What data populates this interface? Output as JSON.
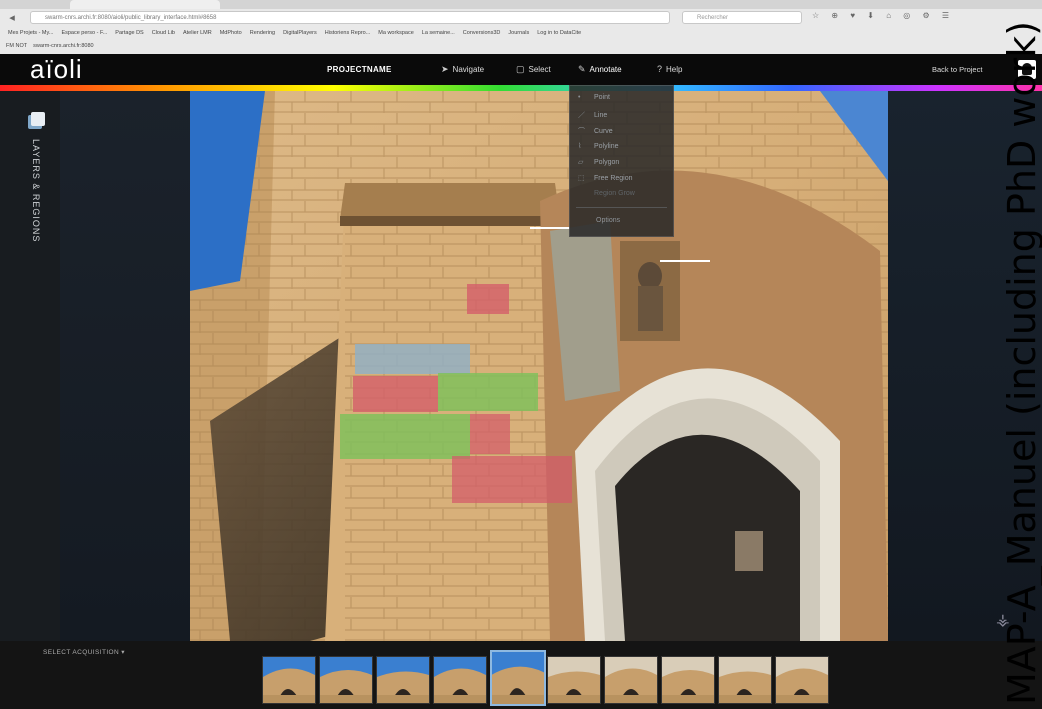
{
  "browser": {
    "url": "swarm-cnrs.archi.fr:8080/aioli/public_library_interface.html#8658",
    "search_placeholder": "Rechercher",
    "bookmarks": [
      "Mes Projets - My...",
      "Espace perso - F...",
      "Partage DS",
      "Cloud Lib",
      "Atelier LMR",
      "MdPhoto",
      "Rendering",
      "DigitalPlayers",
      "Historiens Repro...",
      "Ma workspace",
      "La semaine...",
      "Conversions3D",
      "Journals",
      "Log in to DataCite"
    ],
    "bookmarks2": [
      "FM NOT",
      "swarm-cnrs.archi.fr:8080"
    ]
  },
  "app": {
    "logo": "aïoli",
    "project_name": "PROJECTNAME",
    "menu": [
      {
        "label": "Navigate",
        "icon": "navigate-icon"
      },
      {
        "label": "Select",
        "icon": "select-icon"
      },
      {
        "label": "Annotate",
        "icon": "annotate-icon"
      },
      {
        "label": "Help",
        "icon": "help-icon"
      }
    ],
    "back_to_project": "Back to Project",
    "active_menu": "Annotate"
  },
  "left_panel": {
    "label": "LAYERS & REGIONS"
  },
  "annotate_menu": {
    "items": [
      {
        "label": "Point",
        "icon": "•",
        "enabled": true
      },
      {
        "label": "Line",
        "icon": "／",
        "enabled": true
      },
      {
        "label": "Curve",
        "icon": "⌒",
        "enabled": true
      },
      {
        "label": "Polyline",
        "icon": "⌇",
        "enabled": true
      },
      {
        "label": "Polygon",
        "icon": "▱",
        "enabled": true
      },
      {
        "label": "Free Region",
        "icon": "⬚",
        "enabled": true
      },
      {
        "label": "Region Grow",
        "icon": "",
        "enabled": false
      }
    ],
    "options_label": "Options"
  },
  "bottom_bar": {
    "select_acquisition": "SELECT ACQUISITION",
    "thumbnail_count": 10,
    "selected_thumbnail": 5
  },
  "side_caption": "MAP-A_Manuel (including PhD work)",
  "colors": {
    "appbar": "#0a0a0a",
    "annotation_red": "#d45a6a",
    "annotation_green": "#7cc25a",
    "annotation_blue": "#8fb0c8"
  }
}
